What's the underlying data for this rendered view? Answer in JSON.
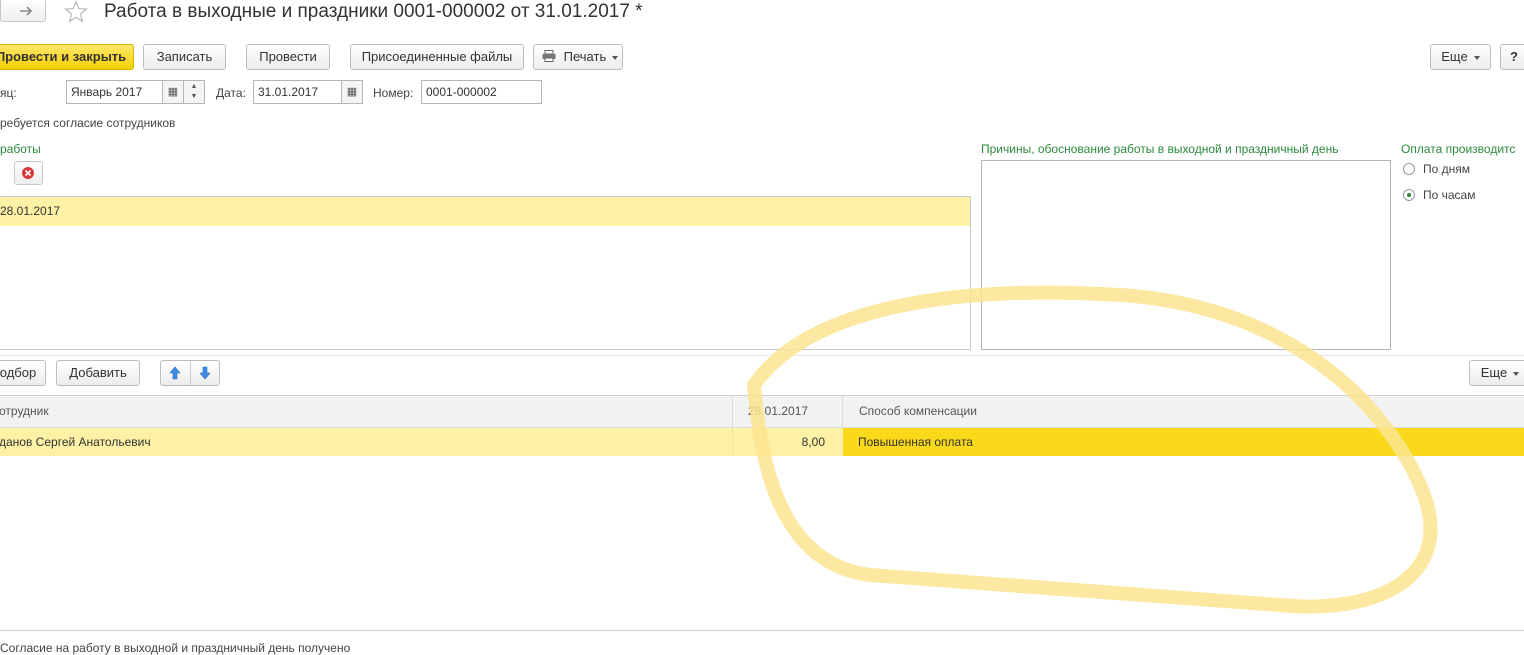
{
  "window": {
    "nav_forward_icon": "arrow-right-icon",
    "favorite_icon": "star-icon",
    "title": "Работа в выходные и праздники 0001-000002 от 31.01.2017 *"
  },
  "toolbar": {
    "post_and_close": "Провести и закрыть",
    "save": "Записать",
    "post": "Провести",
    "attached_files": "Присоединенные файлы",
    "print": "Печать",
    "more": "Еще",
    "help": "?"
  },
  "header_fields": {
    "month_label": "яц:",
    "month_value": "Январь 2017",
    "date_label": "Дата:",
    "date_value": "31.01.2017",
    "number_label": "Номер:",
    "number_value": "0001-000002",
    "consent_required": "ребуется согласие сотрудников"
  },
  "work_dates": {
    "title": "работы",
    "rows": [
      "28.01.2017"
    ]
  },
  "reasons": {
    "title": "Причины, обоснование работы в выходной и праздничный день",
    "value": ""
  },
  "payment": {
    "title": "Оплата производитс",
    "options": [
      "По дням",
      "По часам"
    ],
    "selected": "По часам"
  },
  "employees_toolbar": {
    "pick": "одбор",
    "add": "Добавить",
    "up_icon": "arrow-up-icon",
    "down_icon": "arrow-down-icon",
    "more": "Еще"
  },
  "employees_table": {
    "columns": [
      "отрудник",
      "28.01.2017",
      "Способ компенсации"
    ],
    "rows": [
      {
        "employee": "данов Сергей Анатольевич",
        "hours": "8,00",
        "compensation": "Повышенная оплата"
      }
    ]
  },
  "footer": {
    "consent_received": "Согласие на работу в выходной и праздничный день получено"
  },
  "colors": {
    "primary_button": "#f5d000",
    "row_highlight": "#fdf1a6",
    "cell_selected": "#f9d919",
    "section_title": "#2a8a3c"
  }
}
